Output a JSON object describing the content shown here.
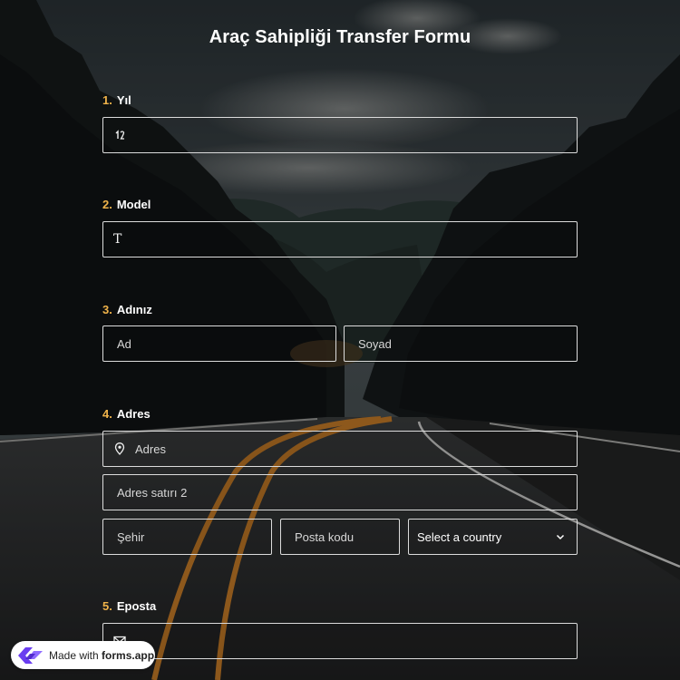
{
  "form": {
    "title": "Araç Sahipliği Transfer Formu"
  },
  "questions": [
    {
      "number": "1.",
      "label": "Yıl"
    },
    {
      "number": "2.",
      "label": "Model"
    },
    {
      "number": "3.",
      "label": "Adınız"
    },
    {
      "number": "4.",
      "label": "Adres"
    },
    {
      "number": "5.",
      "label": "Eposta"
    }
  ],
  "fields": {
    "name_first_placeholder": "Ad",
    "name_last_placeholder": "Soyad",
    "address_placeholder": "Adres",
    "address_line2_placeholder": "Adres satırı 2",
    "city_placeholder": "Şehir",
    "postal_placeholder": "Posta kodu",
    "country_select": "Select a country"
  },
  "icons": {
    "year": "number-input-icon",
    "model": "text-input-icon",
    "address": "location-pin-icon",
    "email": "envelope-icon",
    "country": "chevron-down-icon"
  },
  "badge": {
    "prefix": "Made with ",
    "brand": "forms.app"
  },
  "colors": {
    "accent_number": "#f0b34a",
    "field_border": "#dcdcdc",
    "brand": "#6a3df0"
  }
}
